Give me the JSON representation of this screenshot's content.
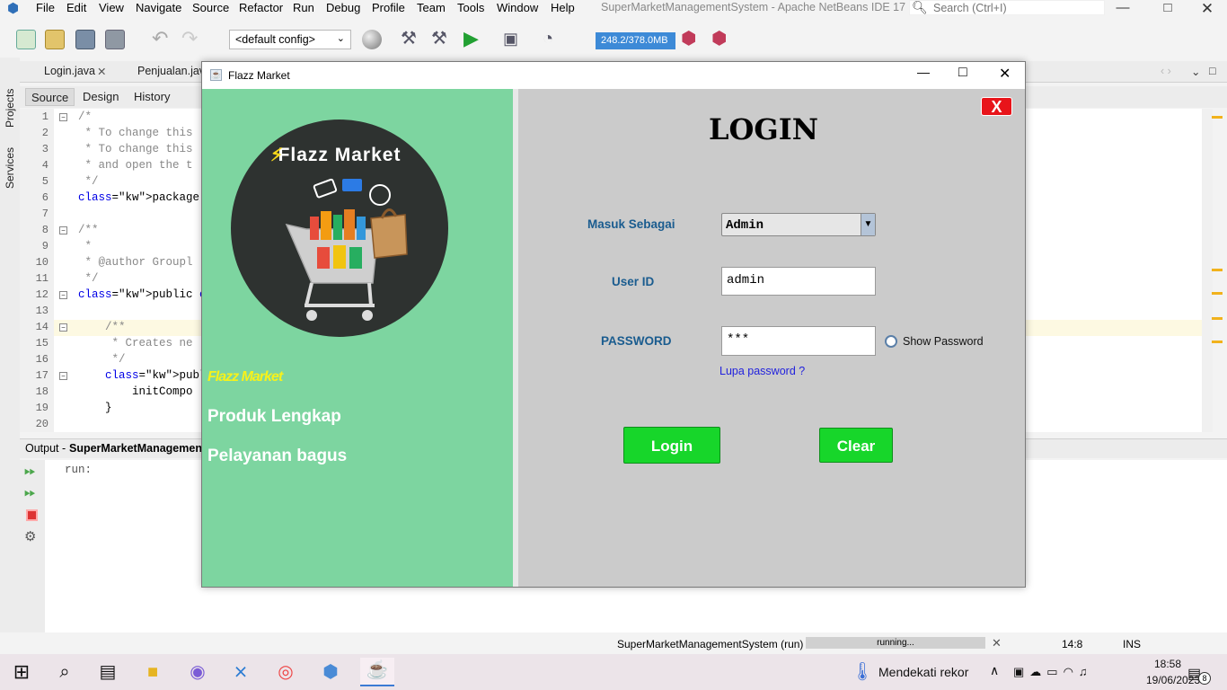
{
  "menu": [
    "File",
    "Edit",
    "View",
    "Navigate",
    "Source",
    "Refactor",
    "Run",
    "Debug",
    "Profile",
    "Team",
    "Tools",
    "Window",
    "Help"
  ],
  "ide_title": "SuperMarketManagementSystem - Apache NetBeans IDE 17",
  "search_placeholder": "Search (Ctrl+I)",
  "config": "<default config>",
  "memory": "248.2/378.0MB",
  "editor_tabs": [
    "Login.java",
    "Penjualan.java"
  ],
  "sub_tabs": [
    "Source",
    "Design",
    "History"
  ],
  "side_labels": [
    "Projects",
    "Services"
  ],
  "code_lines": [
    {
      "n": "1",
      "t": "/*",
      "c": "cm"
    },
    {
      "n": "2",
      "t": " * To change this",
      "c": "cm"
    },
    {
      "n": "3",
      "t": " * To change this",
      "c": "cm"
    },
    {
      "n": "4",
      "t": " * and open the t",
      "c": "cm"
    },
    {
      "n": "5",
      "t": " */",
      "c": "cm"
    },
    {
      "n": "6",
      "t": "package supermark",
      "c": "pk"
    },
    {
      "n": "7",
      "t": "",
      "c": ""
    },
    {
      "n": "8",
      "t": "/**",
      "c": "cm"
    },
    {
      "n": "9",
      "t": " *",
      "c": "cm"
    },
    {
      "n": "10",
      "t": " * @author Groupl",
      "c": "cm"
    },
    {
      "n": "11",
      "t": " */",
      "c": "cm"
    },
    {
      "n": "12",
      "t": "public class Star",
      "c": "pc"
    },
    {
      "n": "13",
      "t": "",
      "c": ""
    },
    {
      "n": "14",
      "t": "    /**",
      "c": "cm"
    },
    {
      "n": "15",
      "t": "     * Creates ne",
      "c": "cm"
    },
    {
      "n": "16",
      "t": "     */",
      "c": "cm"
    },
    {
      "n": "17",
      "t": "    public Start(",
      "c": "ps"
    },
    {
      "n": "18",
      "t": "        initCompo",
      "c": ""
    },
    {
      "n": "19",
      "t": "    }",
      "c": ""
    },
    {
      "n": "20",
      "t": "",
      "c": ""
    }
  ],
  "output_label": "Output - ",
  "output_project": "SuperMarketManagement",
  "output_text": "run:",
  "status": {
    "project": "SuperMarketManagementSystem (run)",
    "progress": "running...",
    "position": "14:8",
    "mode": "INS"
  },
  "taskbar": {
    "weather": "Mendekati rekor",
    "time": "18:58",
    "date": "19/06/2023",
    "notif": "8"
  },
  "dialog": {
    "title": "Flazz Market",
    "logo_text": "Flazz Market",
    "brand_italic": "Flazz Market",
    "tagline1": "Produk Lengkap",
    "tagline2": "Pelayanan bagus",
    "heading": "LOGIN",
    "close_label": "X",
    "label_role": "Masuk Sebagai",
    "role_value": "Admin",
    "label_user": "User ID",
    "user_value": "admin",
    "label_pass": "PASSWORD",
    "pass_value": "***",
    "show_password": "Show Password",
    "forgot": "Lupa password ?",
    "login_btn": "Login",
    "clear_btn": "Clear"
  },
  "colors": {
    "left_panel": "#7dd5a0",
    "right_panel": "#cbcbcb",
    "button": "#17d62a",
    "label": "#1a5c8f",
    "brand": "#f7f21a",
    "close": "#e8141a"
  }
}
